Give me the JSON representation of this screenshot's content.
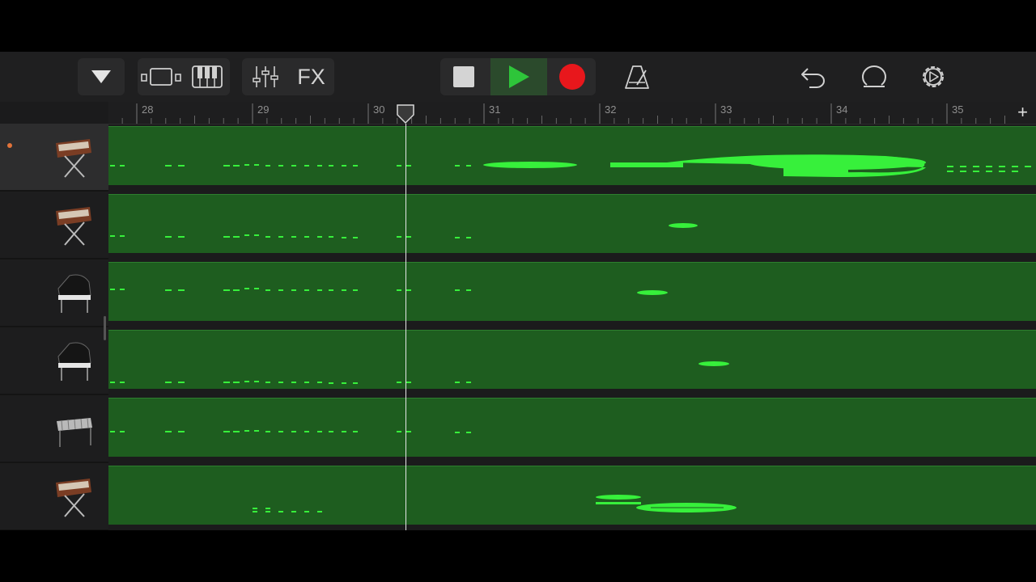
{
  "toolbar": {
    "buttons": [
      {
        "name": "browser-dropdown",
        "icon": "triangle-down-icon"
      },
      {
        "name": "tracks-view",
        "icon": "tracks-view-icon"
      },
      {
        "name": "keyboard",
        "icon": "piano-keys-icon"
      },
      {
        "name": "mixer",
        "icon": "sliders-icon"
      },
      {
        "name": "fx",
        "label": "FX"
      },
      {
        "name": "stop",
        "icon": "stop-icon"
      },
      {
        "name": "play",
        "icon": "play-icon"
      },
      {
        "name": "record",
        "icon": "record-icon"
      },
      {
        "name": "metronome",
        "icon": "metronome-icon"
      },
      {
        "name": "undo",
        "icon": "undo-icon"
      },
      {
        "name": "loop-browser",
        "icon": "loop-icon"
      },
      {
        "name": "settings",
        "icon": "gear-icon"
      }
    ],
    "fx_label": "FX"
  },
  "ruler": {
    "bars": [
      "28",
      "29",
      "30",
      "31",
      "32",
      "33",
      "34",
      "35"
    ],
    "add_track_label": "+"
  },
  "playhead": {
    "bar_position": 30.32
  },
  "tracks": [
    {
      "instrument": "synth-keyboard-icon",
      "selected": true,
      "armed": true
    },
    {
      "instrument": "synth-keyboard-icon",
      "selected": false,
      "armed": false
    },
    {
      "instrument": "grand-piano-icon",
      "selected": false,
      "armed": false
    },
    {
      "instrument": "grand-piano-icon",
      "selected": false,
      "armed": false
    },
    {
      "instrument": "vibraphone-icon",
      "selected": false,
      "armed": false
    },
    {
      "instrument": "synth-keyboard-icon",
      "selected": false,
      "armed": false
    }
  ],
  "colors": {
    "region_fill": "#1e5d1f",
    "note_color": "#37f03b",
    "play_active": "#2ec53a",
    "record": "#e8171c",
    "armed_dot": "#e2733a"
  }
}
